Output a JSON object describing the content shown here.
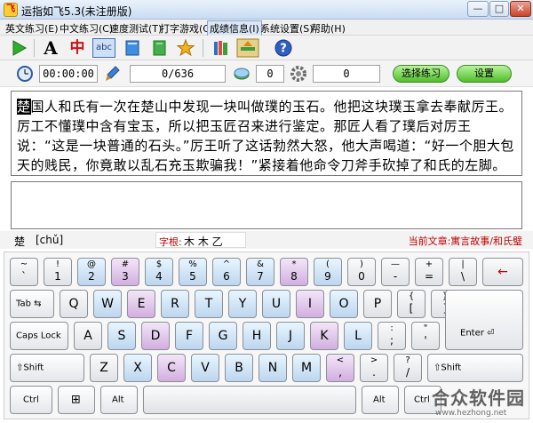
{
  "window": {
    "title": "运指如飞5.3(未注册版)",
    "min": "—",
    "max": "□",
    "close": "✕",
    "app_icon_glyph": "飞"
  },
  "menu": [
    {
      "label": "英文练习(E)",
      "active": false
    },
    {
      "label": "中文练习(C)",
      "active": false
    },
    {
      "label": "速度测试(T)",
      "active": false
    },
    {
      "label": "打字游戏(G)",
      "active": false
    },
    {
      "label": "成绩信息(I)",
      "active": true
    },
    {
      "label": "系统设置(S)",
      "active": false
    },
    {
      "label": "帮助(H)",
      "active": false
    }
  ],
  "toolbar": {
    "icons": [
      "play-icon",
      "font-a-icon",
      "chinese-char-icon",
      "abc-icon",
      "book-icon",
      "notebook-icon",
      "star-icon",
      "bookshelf-icon",
      "book-stack-icon",
      "help-icon"
    ],
    "font_a_glyph": "A",
    "chinese_glyph": "中",
    "abc_glyph": "abc",
    "help_glyph": "?"
  },
  "status": {
    "time": "00:00:00",
    "progress": "0/636",
    "errors": "0",
    "speed": "0",
    "select_button": "选择练习",
    "settings_button": "设置"
  },
  "passage": {
    "current_char": "楚",
    "text": "国人和氏有一次在楚山中发现一块叫做璞的玉石。他把这块璞玉拿去奉献厉王。厉工不懂璞中含有宝玉，所以把玉匠召来进行鉴定。那匠人看了璞后对厉王说：“这是一块普通的石头。”厉王听了这话勃然大怒，他大声喝道：“好一个胆大包天的贱民，你竟敢以乱石充玉欺骗我！”紧接着他命令刀斧手砍掉了和氏的左脚。"
  },
  "input": {
    "value": ""
  },
  "info": {
    "char": "楚",
    "pinyin": "[chǔ]",
    "radix_label": "字根:",
    "radix_value": "木 木 乙",
    "article": "当前文章:寓言故事/和氏璧"
  },
  "keyboard": {
    "row1": [
      {
        "s": "~",
        "m": "`"
      },
      {
        "s": "!",
        "m": "1"
      },
      {
        "s": "@",
        "m": "2"
      },
      {
        "s": "#",
        "m": "3"
      },
      {
        "s": "$",
        "m": "4"
      },
      {
        "s": "%",
        "m": "5"
      },
      {
        "s": "^",
        "m": "6"
      },
      {
        "s": "&",
        "m": "7"
      },
      {
        "s": "*",
        "m": "8"
      },
      {
        "s": "(",
        "m": "9"
      },
      {
        "s": ")",
        "m": "0"
      },
      {
        "s": "—",
        "m": "-"
      },
      {
        "s": "+",
        "m": "="
      },
      {
        "s": "|",
        "m": "\\"
      },
      {
        "s": "",
        "m": "←"
      }
    ],
    "tab": "Tab ⇆",
    "row2": [
      "Q",
      "W",
      "E",
      "R",
      "T",
      "Y",
      "U",
      "I",
      "O",
      "P"
    ],
    "row2_brackets": [
      {
        "s": "{",
        "m": "["
      },
      {
        "s": "}",
        "m": "]"
      }
    ],
    "caps": "Caps Lock",
    "row3": [
      "A",
      "S",
      "D",
      "F",
      "G",
      "H",
      "J",
      "K",
      "L"
    ],
    "row3_punct": [
      {
        "s": ":",
        "m": ";"
      },
      {
        "s": "\"",
        "m": "'"
      }
    ],
    "enter": "Enter ⏎",
    "shift_left": "⇧Shift",
    "row4": [
      "Z",
      "X",
      "C",
      "V",
      "B",
      "N",
      "M"
    ],
    "row4_punct": [
      {
        "s": "<",
        "m": ","
      },
      {
        "s": ">",
        "m": "."
      },
      {
        "s": "?",
        "m": "/"
      }
    ],
    "shift_right": "⇧Shift",
    "ctrl": "Ctrl",
    "win": "⊞",
    "alt_left": "Alt",
    "alt_right": "Alt",
    "ctrl_right": "Ctrl"
  },
  "watermark": {
    "text": "合众软件园",
    "url": "www.hezhong.net"
  }
}
